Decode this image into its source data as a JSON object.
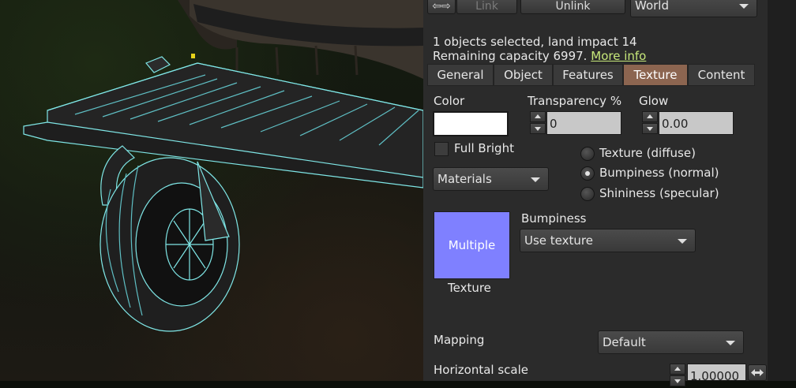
{
  "toolbar": {
    "link_label": "Link",
    "unlink_label": "Unlink",
    "coord_system": "World"
  },
  "selection": {
    "summary": "1 objects selected, land impact 14",
    "remaining_capacity": "Remaining capacity 6997.",
    "more_info_link": "More info"
  },
  "tabs": [
    {
      "label": "General"
    },
    {
      "label": "Object"
    },
    {
      "label": "Features"
    },
    {
      "label": "Texture",
      "active": true
    },
    {
      "label": "Content"
    }
  ],
  "texture_tab": {
    "color_label": "Color",
    "color_value": "#ffffff",
    "transparency_label": "Transparency %",
    "transparency_value": "0",
    "glow_label": "Glow",
    "glow_value": "0.00",
    "full_bright_label": "Full Bright",
    "full_bright_checked": false,
    "mode_dropdown": "Materials",
    "material_channels": [
      {
        "label": "Texture (diffuse)",
        "selected": false
      },
      {
        "label": "Bumpiness (normal)",
        "selected": true
      },
      {
        "label": "Shininess (specular)",
        "selected": false
      }
    ],
    "texture_preview_text": "Multiple",
    "texture_preview_color": "#7f80ff",
    "texture_label": "Texture",
    "bumpiness_label": "Bumpiness",
    "bumpiness_value": "Use texture",
    "mapping_label": "Mapping",
    "mapping_value": "Default",
    "horizontal_scale_label": "Horizontal scale",
    "horizontal_scale_value": "1.00000"
  },
  "colors": {
    "panel_bg": "#2b2b2b",
    "active_tab": "#8c6550",
    "link": "#c7e87a",
    "wireframe": "#7fe6e6"
  }
}
